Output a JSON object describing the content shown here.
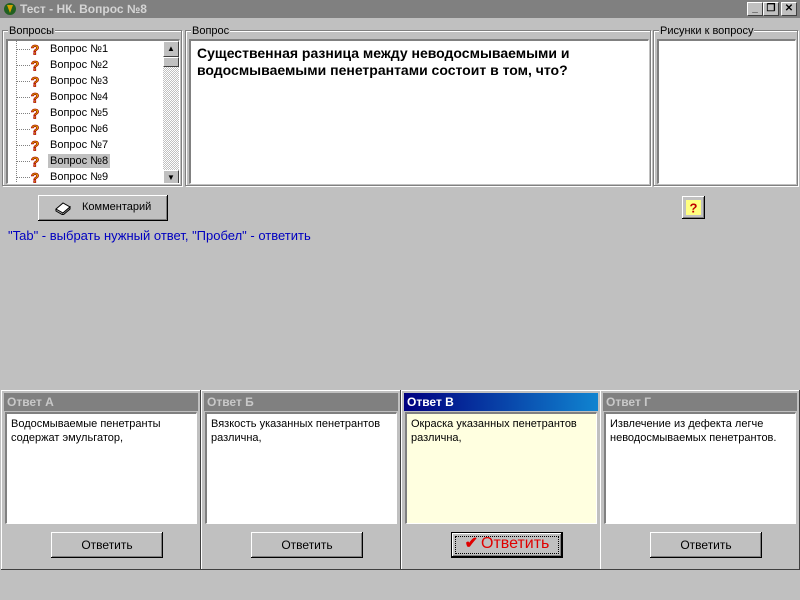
{
  "window": {
    "title": "Тест - НК. Вопрос №8",
    "controls": {
      "minimize": "_",
      "restore": "❐",
      "close": "✕"
    }
  },
  "questions_group": {
    "label": "Вопросы",
    "items": [
      {
        "label": "Вопрос №1"
      },
      {
        "label": "Вопрос №2"
      },
      {
        "label": "Вопрос №3"
      },
      {
        "label": "Вопрос №4"
      },
      {
        "label": "Вопрос №5"
      },
      {
        "label": "Вопрос №6"
      },
      {
        "label": "Вопрос №7"
      },
      {
        "label": "Вопрос №8",
        "selected": true
      },
      {
        "label": "Вопрос №9"
      }
    ]
  },
  "question_group": {
    "label": "Вопрос",
    "text": "Существенная разница между неводосмываемыми и водосмываемыми пенетрантами состоит в том, что?"
  },
  "pictures_group": {
    "label": "Рисунки к вопросу"
  },
  "comment_button": {
    "label": "Комментарий",
    "icon": "book-icon"
  },
  "help_button": {
    "icon": "question-icon"
  },
  "hint": "\"Tab\" - выбрать нужный ответ, \"Пробел\" - ответить",
  "answers": [
    {
      "header": "Ответ А",
      "text": "Водосмываемые пенетранты содержат эмульгатор,",
      "button": "Ответить",
      "active": false
    },
    {
      "header": "Ответ Б",
      "text": "Вязкость указанных пенетрантов различна,",
      "button": "Ответить",
      "active": false
    },
    {
      "header": "Ответ В",
      "text": "Окраска указанных пенетрантов различна,",
      "button": "Ответить",
      "active": true
    },
    {
      "header": "Ответ Г",
      "text": "Извлечение из дефекта легче неводосмываемых пенетрантов.",
      "button": "Ответить",
      "active": false
    }
  ],
  "colors": {
    "window_bg": "#c0c0c0",
    "active_header": "#000080",
    "hint_text": "#0000c0",
    "active_button_text": "#e00000",
    "active_answer_bg": "#ffffe0"
  }
}
